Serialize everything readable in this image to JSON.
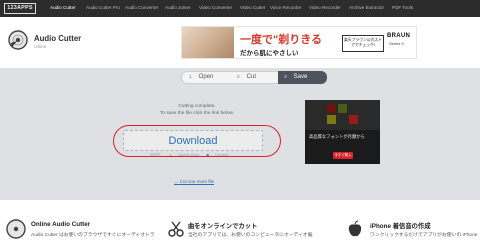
{
  "nav": {
    "logo": "123APPS",
    "links": [
      "Audio Cutter",
      "Audio Cutter Pro",
      "Audio Converter",
      "Audio Joiner",
      "Video Converter",
      "Video Cutter",
      "Voice Recorder",
      "Video Recorder",
      "Archive Extractor",
      "PDF Tools"
    ],
    "active_index": 0
  },
  "header": {
    "title": "Audio Cutter",
    "subtitle": "online",
    "icon": "disc-icon"
  },
  "ad_top": {
    "headline": "一度で\"剃りきる",
    "subline": "だから肌にやさしい",
    "cta": "楽天ブラウン公式ストアでチェック!",
    "brand": "BRAUN",
    "brand_sub": "Series 9"
  },
  "steps": [
    {
      "num": "1",
      "label": "Open"
    },
    {
      "num": "2",
      "label": "Cut"
    },
    {
      "num": "3",
      "label": "Save"
    }
  ],
  "current_step": 3,
  "result": {
    "line1": "Cutting complete.",
    "line2": "To save the file click the link below.",
    "download": "Download",
    "save_label": "保存先:",
    "save_gdrive": "Google Drive",
    "save_dropbox": "Dropbox",
    "cut_another": "Cut one more file"
  },
  "ad_side": {
    "line1": "高品質なフォントが月額から",
    "line2": "今すぐ購入"
  },
  "features": [
    {
      "title": "Online Audio Cutter",
      "text": "Audio Cutter はお使いのブラウザですぐにオーディオトラ",
      "icon": "disc-icon"
    },
    {
      "title": "曲をオンラインでカット",
      "text": "当社のアプリでは、お使いのコンピュータにオーディオ編",
      "icon": "scissors-icon"
    },
    {
      "title": "iPhone 着信音の作成",
      "text": "ワンクリックするだけでアプリがお使いの iPhone",
      "icon": "apple-icon"
    }
  ],
  "colors": {
    "nav_bg": "#2c2c2c",
    "work_bg": "#dfe0e3",
    "link": "#2a6fb7",
    "highlight": "#d9232d",
    "step_current": "#4f535d"
  }
}
